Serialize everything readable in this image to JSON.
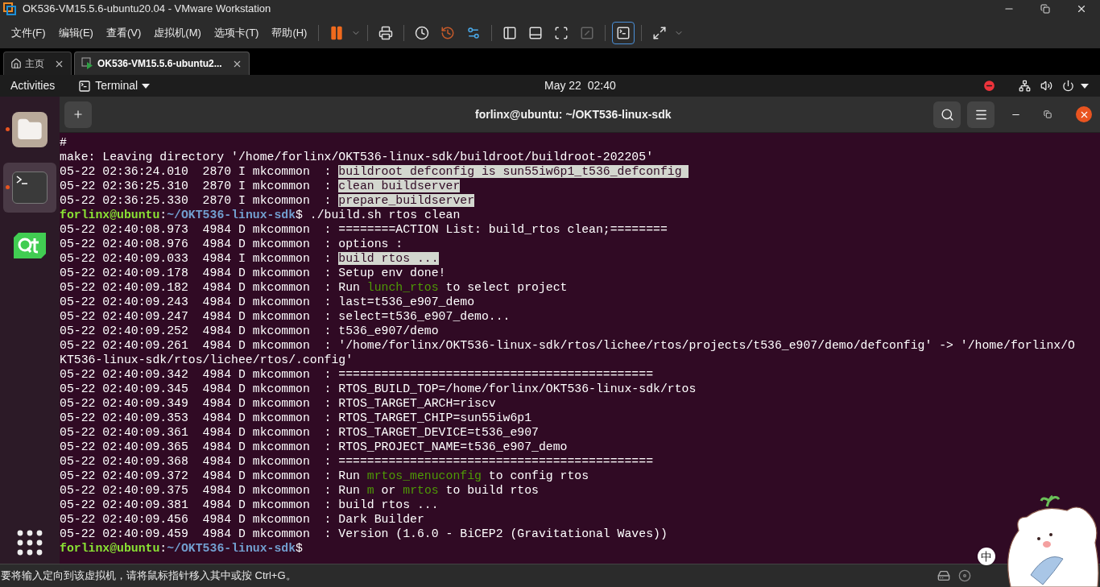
{
  "window": {
    "title": "OK536-VM15.5.6-ubuntu20.04 - VMware Workstation"
  },
  "menu": [
    "文件(F)",
    "编辑(E)",
    "查看(V)",
    "虚拟机(M)",
    "选项卡(T)",
    "帮助(H)"
  ],
  "tabs": [
    {
      "label": "主页",
      "kind": "home",
      "selected": false
    },
    {
      "label": "OK536-VM15.5.6-ubuntu2...",
      "kind": "vm",
      "selected": true
    }
  ],
  "topbar": {
    "activities": "Activities",
    "app": "Terminal",
    "clock": "May 22  02:40"
  },
  "dock": [
    {
      "kind": "files",
      "running": true,
      "selected": false
    },
    {
      "kind": "terminal",
      "running": true,
      "selected": true
    },
    {
      "kind": "qt",
      "running": false,
      "selected": false
    }
  ],
  "terminal": {
    "title": "forlinx@ubuntu: ~/OKT536-linux-sdk",
    "lines": [
      [
        {
          "t": "#",
          "kind": "plain"
        }
      ],
      [
        {
          "t": "make: Leaving directory '/home/forlinx/OKT536-linux-sdk/buildroot/buildroot-202205'",
          "kind": "plain"
        }
      ],
      [
        {
          "t": "05-22 02:36:24.010  2870 I mkcommon  : ",
          "kind": "plain"
        },
        {
          "t": "buildroot defconfig is sun55iw6p1_t536_defconfig ",
          "kind": "highlight"
        }
      ],
      [
        {
          "t": "05-22 02:36:25.310  2870 I mkcommon  : ",
          "kind": "plain"
        },
        {
          "t": "clean buildserver",
          "kind": "highlight"
        }
      ],
      [
        {
          "t": "05-22 02:36:25.330  2870 I mkcommon  : ",
          "kind": "plain"
        },
        {
          "t": "prepare_buildserver",
          "kind": "highlight"
        }
      ],
      [
        {
          "t": "forlinx@ubuntu",
          "kind": "user"
        },
        {
          "t": ":",
          "kind": "plain"
        },
        {
          "t": "~/OKT536-linux-sdk",
          "kind": "path"
        },
        {
          "t": "$ ./build.sh rtos clean",
          "kind": "plain"
        }
      ],
      [
        {
          "t": "05-22 02:40:08.973  4984 D mkcommon  : ========ACTION List: build_rtos clean;========",
          "kind": "plain"
        }
      ],
      [
        {
          "t": "05-22 02:40:08.976  4984 D mkcommon  : options :",
          "kind": "plain"
        }
      ],
      [
        {
          "t": "05-22 02:40:09.033  4984 I mkcommon  : ",
          "kind": "plain"
        },
        {
          "t": "build rtos ...",
          "kind": "highlight"
        }
      ],
      [
        {
          "t": "05-22 02:40:09.178  4984 D mkcommon  : Setup env done!",
          "kind": "plain"
        }
      ],
      [
        {
          "t": "05-22 02:40:09.182  4984 D mkcommon  : Run ",
          "kind": "plain"
        },
        {
          "t": "lunch_rtos",
          "kind": "green"
        },
        {
          "t": " to select project",
          "kind": "plain"
        }
      ],
      [
        {
          "t": "05-22 02:40:09.243  4984 D mkcommon  : last=t536_e907_demo",
          "kind": "plain"
        }
      ],
      [
        {
          "t": "05-22 02:40:09.247  4984 D mkcommon  : select=t536_e907_demo...",
          "kind": "plain"
        }
      ],
      [
        {
          "t": "05-22 02:40:09.252  4984 D mkcommon  : t536_e907/demo",
          "kind": "plain"
        }
      ],
      [
        {
          "t": "05-22 02:40:09.261  4984 D mkcommon  : '/home/forlinx/OKT536-linux-sdk/rtos/lichee/rtos/projects/t536_e907/demo/defconfig' -> '/home/forlinx/O",
          "kind": "plain"
        }
      ],
      [
        {
          "t": "KT536-linux-sdk/rtos/lichee/rtos/.config'",
          "kind": "plain"
        }
      ],
      [
        {
          "t": "05-22 02:40:09.342  4984 D mkcommon  : ============================================",
          "kind": "plain"
        }
      ],
      [
        {
          "t": "05-22 02:40:09.345  4984 D mkcommon  : RTOS_BUILD_TOP=/home/forlinx/OKT536-linux-sdk/rtos",
          "kind": "plain"
        }
      ],
      [
        {
          "t": "05-22 02:40:09.349  4984 D mkcommon  : RTOS_TARGET_ARCH=riscv",
          "kind": "plain"
        }
      ],
      [
        {
          "t": "05-22 02:40:09.353  4984 D mkcommon  : RTOS_TARGET_CHIP=sun55iw6p1",
          "kind": "plain"
        }
      ],
      [
        {
          "t": "05-22 02:40:09.361  4984 D mkcommon  : RTOS_TARGET_DEVICE=t536_e907",
          "kind": "plain"
        }
      ],
      [
        {
          "t": "05-22 02:40:09.365  4984 D mkcommon  : RTOS_PROJECT_NAME=t536_e907_demo",
          "kind": "plain"
        }
      ],
      [
        {
          "t": "05-22 02:40:09.368  4984 D mkcommon  : ============================================",
          "kind": "plain"
        }
      ],
      [
        {
          "t": "05-22 02:40:09.372  4984 D mkcommon  : Run ",
          "kind": "plain"
        },
        {
          "t": "mrtos_menuconfig",
          "kind": "green"
        },
        {
          "t": " to config rtos",
          "kind": "plain"
        }
      ],
      [
        {
          "t": "05-22 02:40:09.375  4984 D mkcommon  : Run ",
          "kind": "plain"
        },
        {
          "t": "m",
          "kind": "green"
        },
        {
          "t": " or ",
          "kind": "plain"
        },
        {
          "t": "mrtos",
          "kind": "green"
        },
        {
          "t": " to build rtos",
          "kind": "plain"
        }
      ],
      [
        {
          "t": "05-22 02:40:09.381  4984 D mkcommon  : build rtos ...",
          "kind": "plain"
        }
      ],
      [
        {
          "t": "05-22 02:40:09.456  4984 D mkcommon  : Dark Builder",
          "kind": "plain"
        }
      ],
      [
        {
          "t": "05-22 02:40:09.459  4984 D mkcommon  : Version (1.6.0 - BiCEP2 (Gravitational Waves))",
          "kind": "plain"
        }
      ],
      [
        {
          "t": "forlinx@ubuntu",
          "kind": "user"
        },
        {
          "t": ":",
          "kind": "plain"
        },
        {
          "t": "~/OKT536-linux-sdk",
          "kind": "path"
        },
        {
          "t": "$",
          "kind": "plain"
        }
      ]
    ]
  },
  "ime": {
    "mode": "中"
  },
  "status_bar": {
    "message": "要将输入定向到该虚拟机，请将鼠标指针移入其中或按 Ctrl+G。"
  }
}
